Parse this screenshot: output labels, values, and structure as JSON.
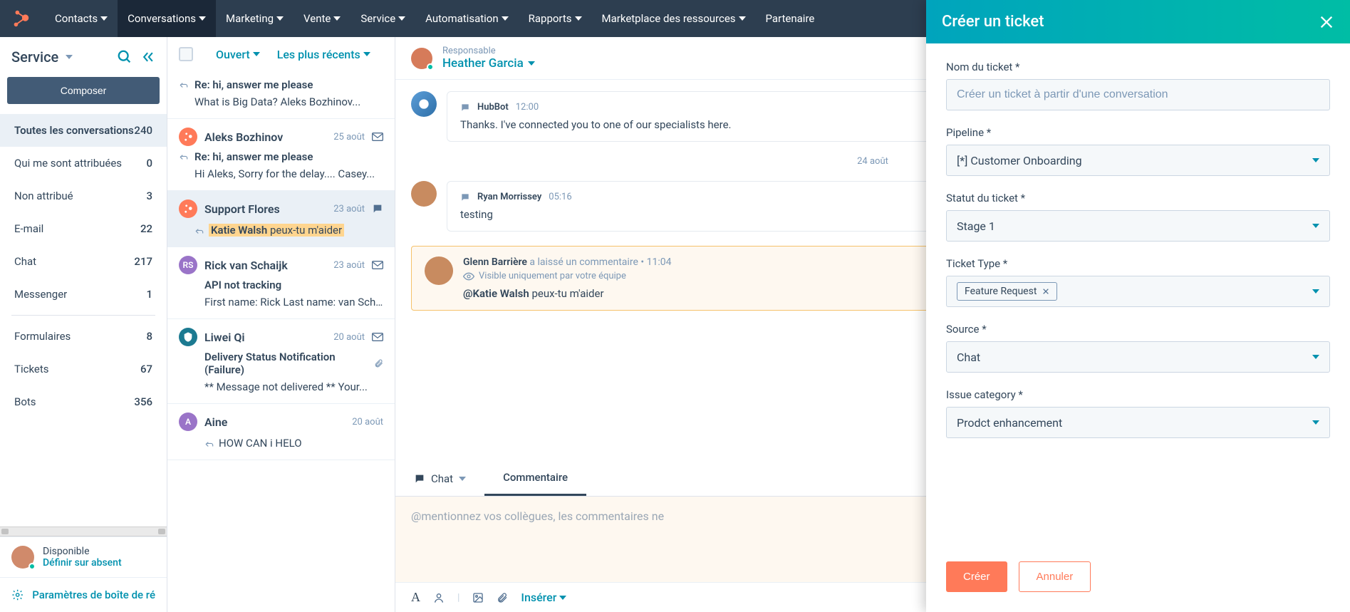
{
  "nav": {
    "items": [
      "Contacts",
      "Conversations",
      "Marketing",
      "Vente",
      "Service",
      "Automatisation",
      "Rapports",
      "Marketplace des ressources",
      "Partenaire"
    ]
  },
  "sidebar": {
    "title": "Service",
    "compose": "Composer",
    "sections": [
      {
        "label": "Toutes les conversations",
        "count": "240",
        "selected": true
      },
      {
        "label": "Qui me sont attribuées",
        "count": "0"
      },
      {
        "label": "Non attribué",
        "count": "3"
      },
      {
        "label": "E-mail",
        "count": "22"
      },
      {
        "label": "Chat",
        "count": "217"
      },
      {
        "label": "Messenger",
        "count": "1"
      }
    ],
    "sections2": [
      {
        "label": "Formulaires",
        "count": "8"
      },
      {
        "label": "Tickets",
        "count": "67"
      },
      {
        "label": "Bots",
        "count": "356"
      }
    ],
    "presence": {
      "status": "Disponible",
      "action": "Définir sur absent"
    },
    "settings": "Paramètres de boîte de ré"
  },
  "convlist": {
    "filter_status": "Ouvert",
    "filter_sort": "Les plus récents",
    "items": [
      {
        "from": "",
        "date": "",
        "subject": "Re: hi, answer me please",
        "preview": "What is Big Data? Aleks Bozhinov...",
        "reply": true
      },
      {
        "from": "Aleks Bozhinov",
        "date": "25 août",
        "subject": "Re: hi, answer me please",
        "preview": "Hi Aleks, Sorry for the delay.... Casey...",
        "avatar_type": "hub",
        "channel": "email",
        "reply": true
      },
      {
        "from": "Support Flores",
        "date": "23 août",
        "preview_mention": "Katie Walsh",
        "preview_rest": " peux-tu m'aider",
        "avatar_type": "hub",
        "channel": "chat",
        "selected": true,
        "reply": true
      },
      {
        "from": "Rick van Schaijk",
        "date": "23 août",
        "subject": "API not tracking",
        "preview": "First name: Rick Last name: van Scha...",
        "avatar_text": "RS",
        "avatar_class": "purple",
        "channel": "email"
      },
      {
        "from": "Liwei Qi",
        "date": "20 août",
        "subject": "Delivery Status Notification (Failure)",
        "preview": "** Message not delivered ** Your...",
        "avatar_class": "teal",
        "channel": "email",
        "attach": true
      },
      {
        "from": "Aine",
        "date": "20 août",
        "subject": "",
        "preview": "HOW CAN i HELO",
        "avatar_text": "A",
        "avatar_class": "purple",
        "reply": true
      }
    ]
  },
  "thread": {
    "owner_label": "Responsable",
    "owner_name": "Heather Garcia",
    "messages": [
      {
        "who": "HubBot",
        "time": "12:00",
        "text": "Thanks. I've connected you to one of our specialists here.",
        "bot": true
      },
      {
        "sep": "24 août"
      },
      {
        "who": "Ryan Morrissey",
        "time": "05:16",
        "text": "testing"
      }
    ],
    "comment": {
      "author": "Glenn Barrière",
      "action": "a laissé un commentaire",
      "time": "11:04",
      "visibility": "Visible uniquement par votre équipe",
      "mention": "@Katie Walsh",
      "rest": " peux-tu m'aider"
    },
    "composer": {
      "tab_chat": "Chat",
      "tab_comment": "Commentaire",
      "placeholder": "@mentionnez vos collègues, les commentaires ne",
      "insert": "Insérer"
    }
  },
  "modal": {
    "title": "Créer un ticket",
    "fields": {
      "name_label": "Nom du ticket *",
      "name_placeholder": "Créer un ticket à partir d'une conversation",
      "pipeline_label": "Pipeline *",
      "pipeline_value": "[*] Customer Onboarding",
      "status_label": "Statut du ticket *",
      "status_value": "Stage 1",
      "type_label": "Ticket Type *",
      "type_value": "Feature Request",
      "source_label": "Source *",
      "source_value": "Chat",
      "issue_label": "Issue category *",
      "issue_value": "Prodct enhancement"
    },
    "create": "Créer",
    "cancel": "Annuler"
  }
}
